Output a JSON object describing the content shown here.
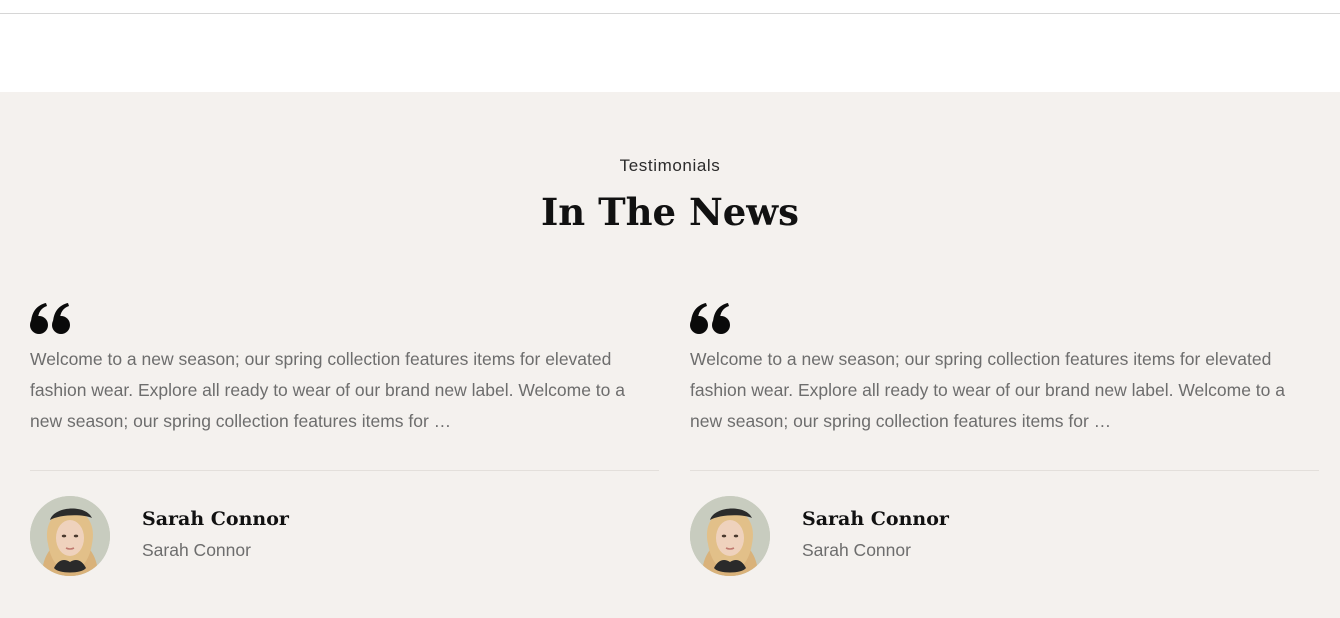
{
  "section": {
    "eyebrow": "Testimonials",
    "title": "In The News"
  },
  "testimonials": [
    {
      "quote": "Welcome to a new season; our spring collection features items for elevated fashion wear. Explore all ready to wear of our brand new label. Welcome to a new season; our spring collection features items for …",
      "author_name": "Sarah Connor",
      "author_role": "Sarah Connor",
      "icon": "quote-icon"
    },
    {
      "quote": "Welcome to a new season; our spring collection features items for elevated fashion wear. Explore all ready to wear of our brand new label. Welcome to a new season; our spring collection features items for …",
      "author_name": "Sarah Connor",
      "author_role": "Sarah Connor",
      "icon": "quote-icon"
    }
  ],
  "colors": {
    "section_background": "#f4f1ee",
    "heading": "#111111",
    "body_text": "#6d6d6d"
  }
}
